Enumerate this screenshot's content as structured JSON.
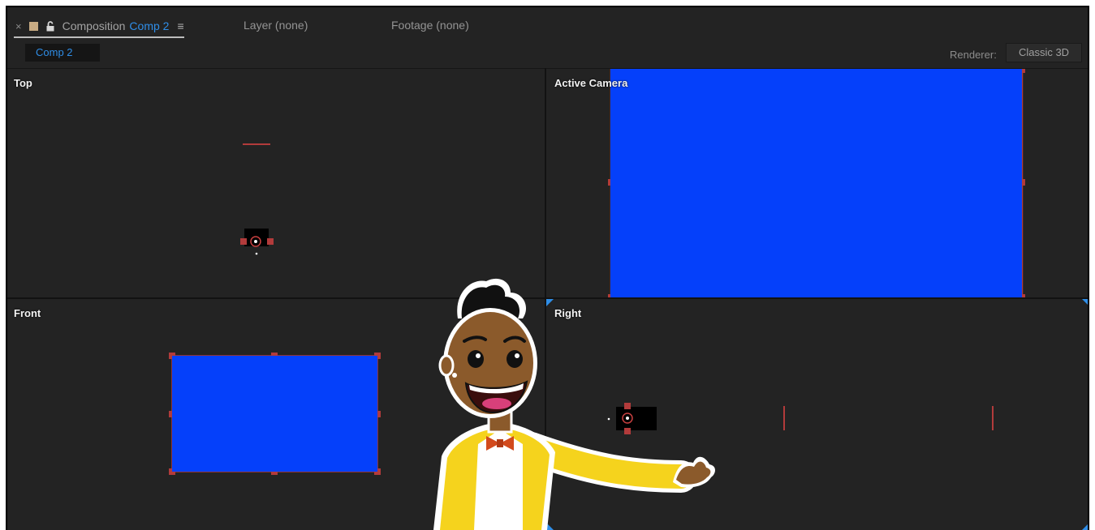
{
  "panel": {
    "close_glyph": "×",
    "tab_prefix": "Composition",
    "tab_name": "Comp 2",
    "menu_glyph": "≡",
    "layer_tab": "Layer (none)",
    "footage_tab": "Footage (none)",
    "flowchart_chip": "Comp 2",
    "renderer_label": "Renderer:",
    "renderer_value": "Classic 3D",
    "swatch_color": "#c9ab83",
    "accent_color": "#2f8ee8"
  },
  "views": {
    "top": "Top",
    "active_camera": "Active Camera",
    "front": "Front",
    "right": "Right"
  },
  "colors": {
    "layer_fill": "#0540fa",
    "handle": "#b23b3b",
    "panel_bg": "#232323",
    "view_active_corner": "#2f8ee8"
  }
}
